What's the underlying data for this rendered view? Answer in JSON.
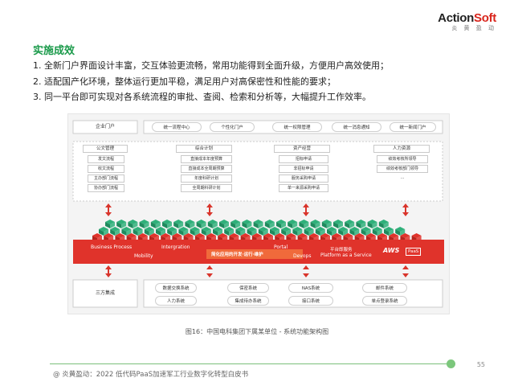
{
  "logo": {
    "brand_a": "Action",
    "brand_b": "Soft",
    "tagline": "炎 黄 盈 动"
  },
  "heading": "实施成效",
  "points": [
    "1.  全新门户界面设计丰富，交互体验更流畅，常用功能得到全面升级，方便用户高效使用；",
    "2.  适配国产化环境，整体运行更加平稳，满足用户对高保密性和性能的要求；",
    "3.  同一平台即可实现对各系统流程的审批、查阅、检索和分析等，大幅提升工作效率。"
  ],
  "figure": {
    "portal": {
      "label": "企业门户",
      "items": [
        "统一流程中心",
        "个性化门户",
        "统一权限管理",
        "统一消息通知",
        "统一新闻门户"
      ]
    },
    "modules": [
      {
        "title": "公文管理",
        "items": [
          "发文流程",
          "收文流程",
          "主办部门流程",
          "协办部门流程"
        ]
      },
      {
        "title": "综合计划",
        "items": [
          "直接成本年度预算",
          "直接成本全周期预算",
          "年度科研计划",
          "全周期科研计划"
        ]
      },
      {
        "title": "资产经营",
        "items": [
          "招标申请",
          "非招标申请",
          "服务采购申请",
          "单一来源采购申请"
        ]
      },
      {
        "title": "人力资源",
        "items": [
          "绩效考核所领导",
          "绩效考核部门领导",
          "..."
        ]
      }
    ],
    "band": {
      "business_process": "Business Process",
      "mobility": "Mobility",
      "integration": "Intergration",
      "core": "简化应用的开发·运行·维护",
      "portal": "Portal",
      "devops": "Devops",
      "platform_cn": "平台即服务",
      "platform_en": "Platform as a Service",
      "brand": "AWS",
      "brand_tag": "PaaS",
      "color": "#e0332b"
    },
    "integration": {
      "label": "三方集成",
      "items": [
        "数据交换系统",
        "人力系统",
        "保密系统",
        "集成待办系统",
        "NAS系统",
        "接口系统",
        "邮件系统",
        "单点登录系统"
      ]
    }
  },
  "caption": "图16：中国电科集团下属某单位 - 系统功能架构图",
  "page_number": "55",
  "footer": "@ 炎黄盈动：2022 低代码PaaS加速军工行业数字化转型白皮书"
}
